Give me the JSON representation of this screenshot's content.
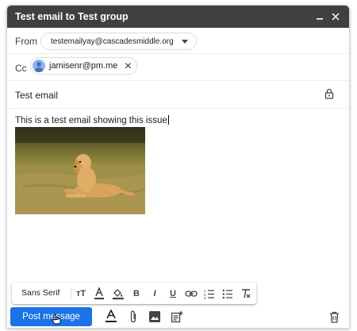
{
  "window": {
    "title": "Test email to Test group"
  },
  "from": {
    "label": "From",
    "value": "testemailyay@cascadesmiddle.org"
  },
  "cc": {
    "label": "Cc",
    "recipient": "jamisenr@pm.me"
  },
  "subject": {
    "value": "Test email"
  },
  "body": {
    "text": "This is a test email showing this issue"
  },
  "format_toolbar": {
    "font": "Sans Serif",
    "tools": [
      "text-size-icon",
      "text-color-icon",
      "highlight-icon",
      "bold-icon",
      "italic-icon",
      "underline-icon",
      "link-icon",
      "numbered-list-icon",
      "bulleted-list-icon",
      "clear-format-icon"
    ]
  },
  "actions": {
    "send_label": "Post message"
  },
  "colors": {
    "titlebar": "#404040",
    "send_button": "#1a73e8",
    "avatar": "#8ab4f8"
  }
}
